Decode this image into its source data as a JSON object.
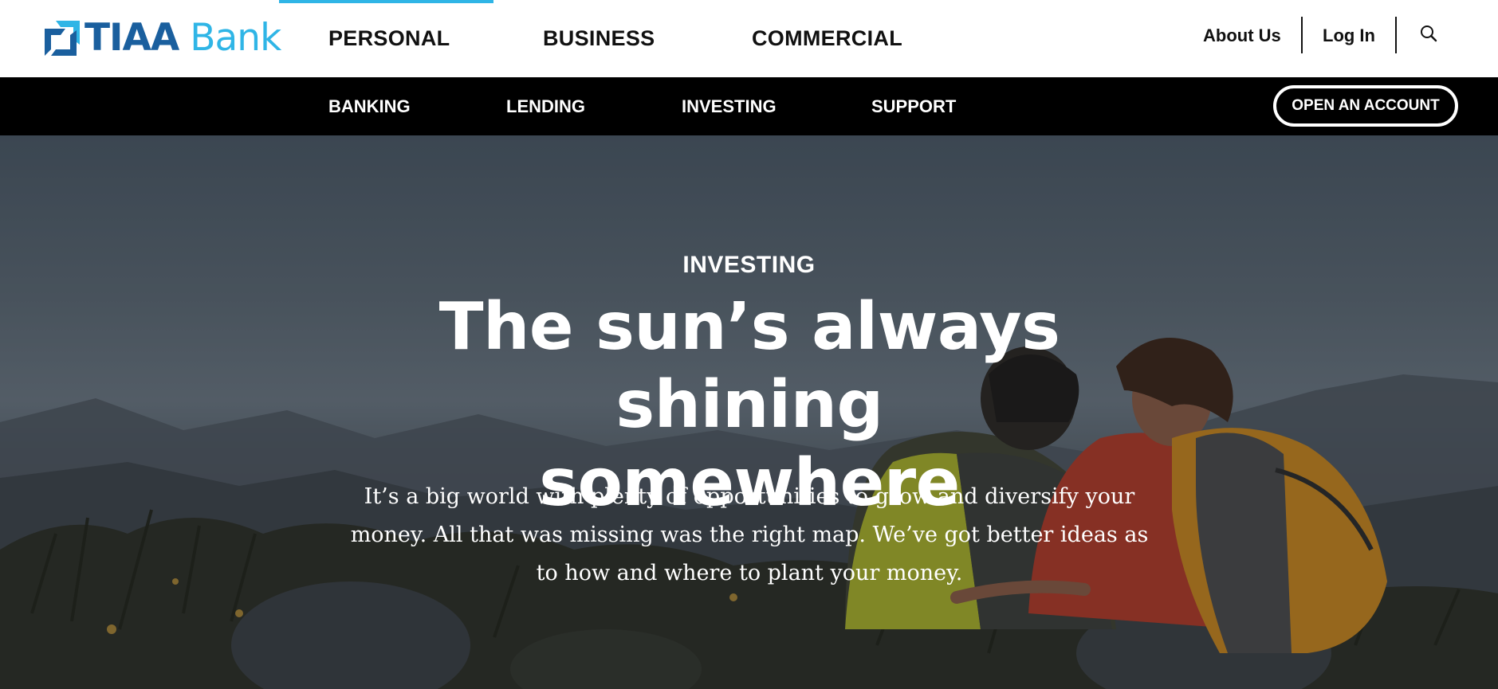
{
  "brand": {
    "name_part1": "TIAA",
    "name_part2": "Bank",
    "logo_icon": "tiaa-square-logo-icon",
    "colors": {
      "primary": "#1a5f9e",
      "accent": "#2fb5e6"
    }
  },
  "primary_nav": {
    "items": [
      {
        "label": "PERSONAL",
        "active": true
      },
      {
        "label": "BUSINESS",
        "active": false
      },
      {
        "label": "COMMERCIAL",
        "active": false
      }
    ],
    "active_indicator_color": "#2fb5e6"
  },
  "utility_nav": {
    "about_label": "About Us",
    "login_label": "Log In",
    "search_icon": "search-icon"
  },
  "sub_nav": {
    "items": [
      {
        "label": "BANKING"
      },
      {
        "label": "LENDING"
      },
      {
        "label": "INVESTING"
      },
      {
        "label": "SUPPORT"
      }
    ],
    "cta_label": "OPEN AN ACCOUNT",
    "background": "#000000"
  },
  "hero": {
    "eyebrow": "INVESTING",
    "headline_line1": "The sun’s always shining",
    "headline_line2": "somewhere",
    "body": "It’s a big world with plenty of opportunities to grow and diversify your money. All that was missing was the right map. We’ve got better ideas as to how and where to plant your money.",
    "image_description_icon": "hikers-mountain-photo"
  }
}
